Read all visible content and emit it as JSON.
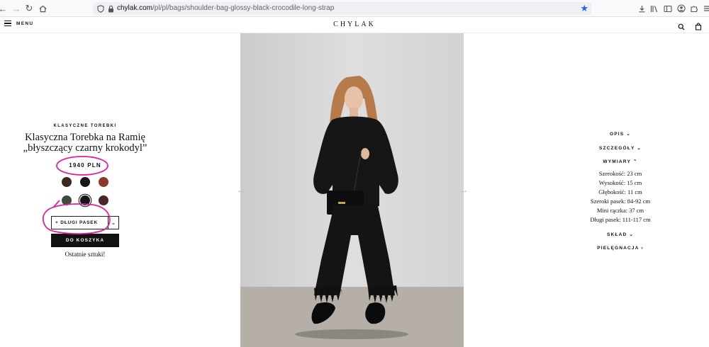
{
  "browser": {
    "url_domain": "chylak.com",
    "url_path": "/pl/pl/bags/shoulder-bag-glossy-black-crocodile-long-strap"
  },
  "header": {
    "menu_label": "MENU",
    "logo": "CHYLAK"
  },
  "product": {
    "category": "KLASYCZNE TOREBKI",
    "title_line1": "Klasyczna Torebka na Ramię",
    "title_line2": "„błyszczący czarny krokodyl”",
    "price": "1940 PLN",
    "swatches": [
      {
        "color": "#3b2a20",
        "selected": false
      },
      {
        "color": "#161616",
        "selected": false
      },
      {
        "color": "#8a3a2c",
        "selected": false
      },
      {
        "color": "#3f4b3c",
        "selected": false
      },
      {
        "color": "#151515",
        "selected": true
      },
      {
        "color": "#4a2628",
        "selected": false
      }
    ],
    "strap_option": "+ DŁUGI PASEK",
    "add_to_cart": "DO KOSZYKA",
    "stock_note": "Ostatnie sztuki!"
  },
  "info": {
    "opis": "OPIS",
    "szczegoly": "SZCZEGÓŁY",
    "wymiary": "WYMIARY",
    "dimensions": [
      "Szerokość: 23 cm",
      "Wysokość: 15 cm",
      "Głębokość: 11 cm",
      "Szeroki pasek: 84-92 cm",
      "Mini rączka: 37 cm",
      "Długi pasek: 111-117 cm"
    ],
    "sklad": "SKŁAD",
    "pielegnacja": "PIELĘGNACJA"
  },
  "colors": {
    "annotation": "#e0219c",
    "accent_star": "#1c6bd6"
  }
}
